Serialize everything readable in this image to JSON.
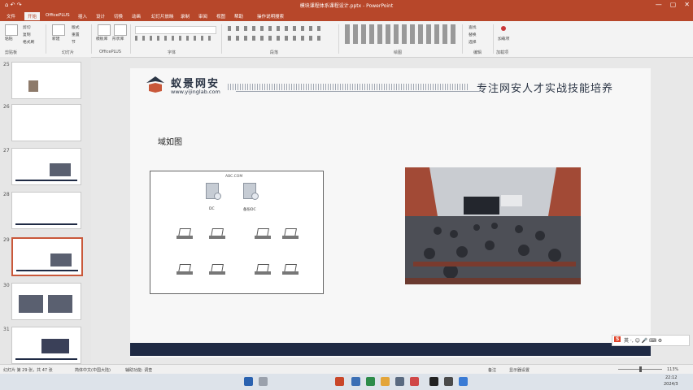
{
  "window": {
    "title": "模块课程体系课程设计.pptx - PowerPoint",
    "quick_access": "⌂ ↶ ↷",
    "controls": [
      "—",
      "▢",
      "✕"
    ]
  },
  "tabs": [
    "文件",
    "开始",
    "OfficePLUS",
    "插入",
    "设计",
    "切换",
    "动画",
    "幻灯片放映",
    "录制",
    "审阅",
    "视图",
    "帮助",
    "操作说明搜索"
  ],
  "ribbon": {
    "groups": [
      "剪贴板",
      "幻灯片",
      "OfficePLUS",
      "字体",
      "段落",
      "绘图",
      "编辑",
      "加载项"
    ],
    "clipboard": {
      "paste": "粘贴",
      "cut": "剪切",
      "copy": "复制",
      "painter": "格式刷"
    },
    "slides": {
      "new": "新建",
      "layout": "版式",
      "reset": "重置",
      "section": "节"
    },
    "officeplus": {
      "a": "模板库",
      "b": "形状库"
    },
    "edit": {
      "find": "查找",
      "replace": "替换",
      "select": "选择"
    },
    "addin": "加载项"
  },
  "thumbnails": [
    {
      "num": "25"
    },
    {
      "num": "26"
    },
    {
      "num": "27"
    },
    {
      "num": "28"
    },
    {
      "num": "29",
      "selected": true
    },
    {
      "num": "30"
    },
    {
      "num": "31"
    }
  ],
  "slide": {
    "logo_text": "蚁景网安",
    "logo_url": "www.yijinglab.com",
    "tagline": "专注网安人才实战技能培养",
    "heading": "域如图",
    "diagram": {
      "domain_label": "ABC.COM",
      "server1": "DC",
      "server2": "备份DC"
    }
  },
  "ime": {
    "label": "S",
    "items": "英 ·, ☺ 🎤 ⌨ ⚙"
  },
  "status": {
    "slide_count": "幻灯片 第 29 张，共 47 张",
    "language": "简体中文(中国大陆)",
    "accessibility": "辅助功能: 调查",
    "notes": "备注",
    "comments": "显示器设置",
    "zoom": "113%"
  },
  "taskbar": {
    "time": "22:12",
    "date": "2024/3"
  }
}
